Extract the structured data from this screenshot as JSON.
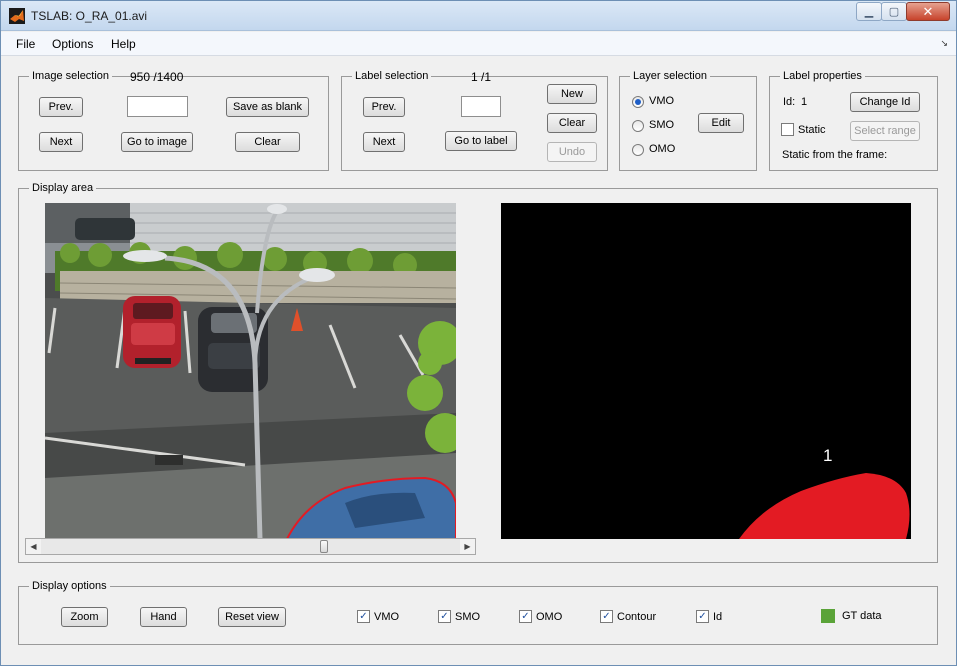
{
  "window": {
    "title": "TSLAB: O_RA_01.avi"
  },
  "menu": {
    "file": "File",
    "options": "Options",
    "help": "Help"
  },
  "image_selection": {
    "legend": "Image selection",
    "counter": "950 /1400",
    "prev": "Prev.",
    "next": "Next",
    "go_to": "Go to image",
    "save_blank": "Save as blank",
    "clear": "Clear",
    "input_value": ""
  },
  "label_selection": {
    "legend": "Label selection",
    "counter": "1 /1",
    "prev": "Prev.",
    "next": "Next",
    "go_to": "Go to label",
    "new": "New",
    "clear": "Clear",
    "undo": "Undo",
    "input_value": ""
  },
  "layer_selection": {
    "legend": "Layer selection",
    "options": [
      "VMO",
      "SMO",
      "OMO"
    ],
    "selected": "VMO",
    "edit": "Edit"
  },
  "label_properties": {
    "legend": "Label properties",
    "id_label": "Id:",
    "id_value": "1",
    "change_id": "Change Id",
    "static_label": "Static",
    "static_checked": false,
    "select_range": "Select range",
    "static_from": "Static from the frame:"
  },
  "display_area": {
    "legend": "Display area",
    "mask_label": "1"
  },
  "display_options": {
    "legend": "Display options",
    "zoom": "Zoom",
    "hand": "Hand",
    "reset": "Reset view",
    "checks": [
      {
        "label": "VMO",
        "checked": true
      },
      {
        "label": "SMO",
        "checked": true
      },
      {
        "label": "OMO",
        "checked": true
      },
      {
        "label": "Contour",
        "checked": true
      },
      {
        "label": "Id",
        "checked": true
      }
    ],
    "gt_label": "GT data",
    "gt_color": "#5aa338"
  },
  "icons": {
    "app": "matlab-icon",
    "minimize": "minimize-icon",
    "maximize": "maximize-icon",
    "close": "close-icon",
    "dock": "dock-arrow-icon",
    "scroll_left": "arrow-left-icon",
    "scroll_right": "arrow-right-icon"
  },
  "colors": {
    "mask_fill": "#e31b23",
    "contour": "#e31b23",
    "check": "#1e4f9e"
  }
}
